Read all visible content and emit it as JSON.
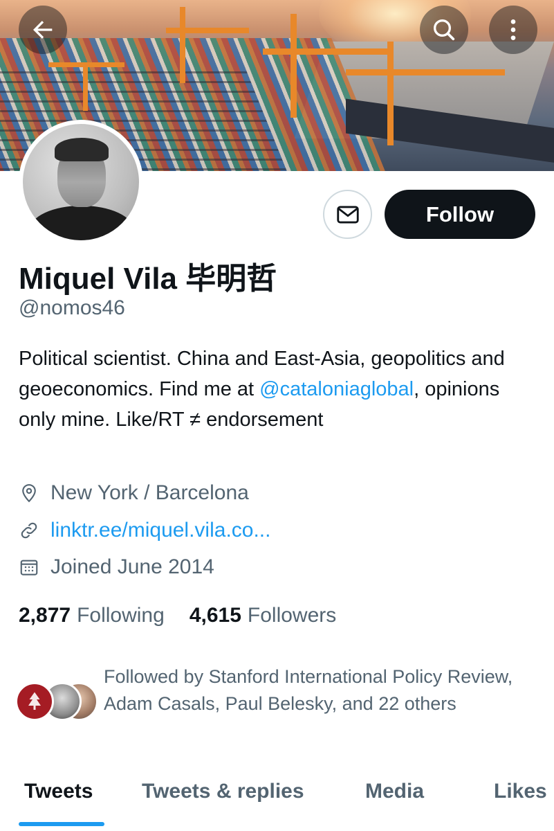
{
  "header": {
    "back_icon": "arrow-left-icon",
    "search_icon": "search-icon",
    "more_icon": "more-vertical-icon"
  },
  "profile": {
    "name": "Miquel Vila 毕明哲",
    "handle": "@nomos46",
    "message_icon": "envelope-icon",
    "follow_label": "Follow",
    "bio": {
      "part1": "Political scientist. China and East-Asia, geopolitics and geoeconomics. Find me at ",
      "mention": "@cataloniaglobal",
      "part2": ", opinions only mine. Like/RT ≠ endorsement"
    },
    "location": "New York / Barcelona",
    "website": "linktr.ee/miquel.vila.co...",
    "joined": "Joined June 2014",
    "following_count": "2,877",
    "following_label": "Following",
    "followers_count": "4,615",
    "followers_label": "Followers",
    "followed_by": "Followed by Stanford International Policy Review, Adam Casals, Paul Belesky, and 22 others"
  },
  "tabs": [
    {
      "label": "Tweets",
      "active": true
    },
    {
      "label": "Tweets & replies",
      "active": false
    },
    {
      "label": "Media",
      "active": false
    },
    {
      "label": "Likes",
      "active": false
    }
  ],
  "colors": {
    "accent": "#1d9bf0",
    "text_primary": "#0f1419",
    "text_secondary": "#536471",
    "follow_button_bg": "#0f1419"
  }
}
